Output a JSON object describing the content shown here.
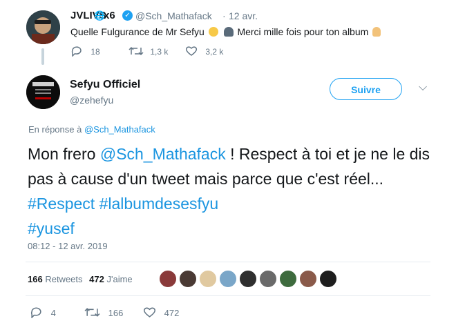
{
  "parent_tweet": {
    "name": "JVLIVS",
    "badge": "x6",
    "handle": "@Sch_Mathafack",
    "separator": "·",
    "date": "12 avr.",
    "text_before": "Quelle Fulgurance de Mr Sefyu",
    "text_after": "Merci mille fois pour ton album",
    "replies": "18",
    "retweets": "1,3 k",
    "likes": "3,2 k"
  },
  "main_tweet": {
    "name": "Sefyu Officiel",
    "handle": "@zehefyu",
    "follow_label": "Suivre",
    "reply_prefix": "En réponse à",
    "reply_to": "@Sch_Mathafack",
    "text": {
      "p1": "Mon frero ",
      "mention": "@Sch_Mathafack",
      "p2": " ! Respect à toi et je ne le dis pas à cause d'un tweet mais parce que c'est réel... ",
      "tag1": "#Respect",
      "space": " ",
      "tag2": "#lalbumdesesfyu",
      "tag3": "#yusef"
    },
    "timestamp": "08:12 - 12 avr. 2019",
    "retweet_count": "166",
    "retweet_label": "Retweets",
    "like_count": "472",
    "like_label": "J'aime",
    "actions": {
      "replies": "4",
      "retweets": "166",
      "likes": "472"
    }
  },
  "colors": {
    "link": "#1b95e0",
    "follow": "#1da1f2",
    "muted": "#657786"
  }
}
